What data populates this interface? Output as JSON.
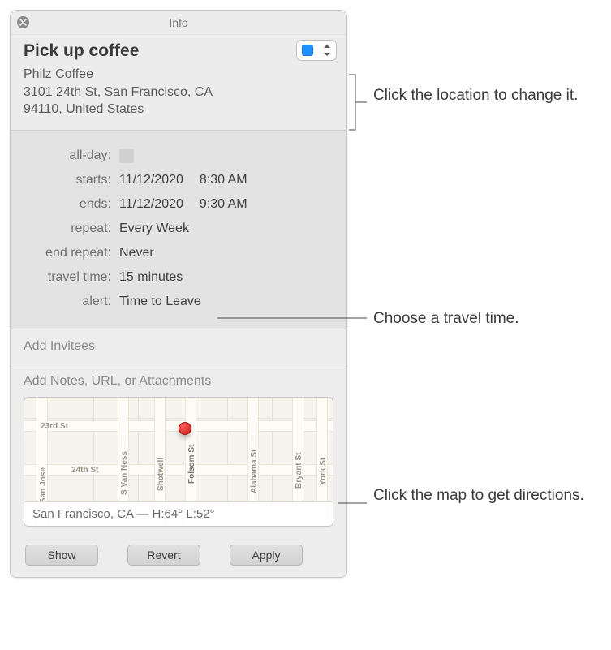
{
  "window": {
    "title": "Info"
  },
  "event": {
    "title": "Pick up coffee",
    "location_name": "Philz Coffee",
    "address_line1": "3101 24th St, San Francisco, CA",
    "address_line2": "94110, United States"
  },
  "details": {
    "labels": {
      "allday": "all-day:",
      "starts": "starts:",
      "ends": "ends:",
      "repeat": "repeat:",
      "end_repeat": "end repeat:",
      "travel_time": "travel time:",
      "alert": "alert:"
    },
    "starts_date": "11/12/2020",
    "starts_time": "8:30 AM",
    "ends_date": "11/12/2020",
    "ends_time": "9:30 AM",
    "repeat": "Every Week",
    "end_repeat": "Never",
    "travel_time": "15 minutes",
    "alert": "Time to Leave"
  },
  "invitees_placeholder": "Add Invitees",
  "notes_placeholder": "Add Notes, URL, or Attachments",
  "map": {
    "streets": {
      "s23rd": "23rd St",
      "s24th": "24th St",
      "svanness": "S Van Ness",
      "folsom": "Folsom St",
      "shotwell": "Shotwell",
      "alabama": "Alabama St",
      "bryant": "Bryant St",
      "york": "York St",
      "sanjose": "San Jose"
    },
    "weather": "San Francisco, CA — H:64° L:52°"
  },
  "buttons": {
    "show": "Show",
    "revert": "Revert",
    "apply": "Apply"
  },
  "annotations": {
    "location": "Click the location to change it.",
    "travel": "Choose a travel time.",
    "map": "Click the map to get directions."
  }
}
